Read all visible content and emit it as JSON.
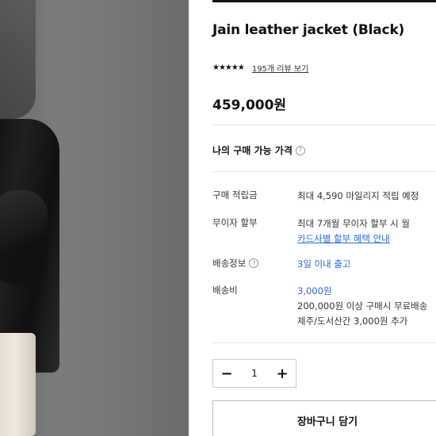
{
  "product": {
    "title": "Jain leather jacket (Black)",
    "stars": "★★★★★",
    "review_link": "195개 리뷰 보기",
    "price": "459,000원"
  },
  "my_price": {
    "label": "나의 구매 가능 가격",
    "help_icon": "?"
  },
  "info": {
    "points_label": "구매 적립금",
    "points_value": "최대 4,590 마일리지 적립 예정",
    "installment_label": "무이자 할부",
    "installment_value": "최대 7개월 무이자 할부 시 월",
    "installment_link": "카드사별 할부 혜택 안내",
    "shipping_info_label": "배송정보",
    "shipping_info_help": "?",
    "shipping_info_value": "3일 이내 출고",
    "shipping_fee_label": "배송비",
    "shipping_fee_value": "3,000원",
    "shipping_free_note": "200,000원 이상 구매시 무료배송",
    "shipping_island_note": "제주/도서산간 3,000원 추가"
  },
  "quantity": {
    "minus": "−",
    "value": "1",
    "plus": "+"
  },
  "cart_button": "장바구니 담기",
  "colors": {
    "link_blue": "#2a6bd6",
    "text": "#111111"
  },
  "icons": [
    "star-rating-icon",
    "question-help-icon",
    "minus-icon",
    "plus-icon"
  ]
}
